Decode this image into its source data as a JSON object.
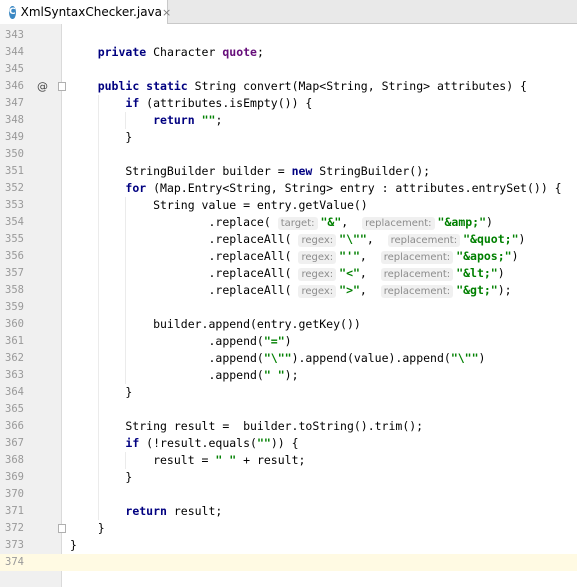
{
  "tab": {
    "icon_label": "C",
    "title": "XmlSyntaxChecker.java",
    "close_label": "×"
  },
  "gutter": {
    "annotation": "@"
  },
  "lines": [
    {
      "num": "343",
      "html": ""
    },
    {
      "num": "344",
      "html": "    <span class=\"kw\">private</span> Character <span class=\"fld\">quote</span>;"
    },
    {
      "num": "345",
      "html": ""
    },
    {
      "num": "346",
      "html": "    <span class=\"kw\">public static</span> String convert(Map&lt;String, String&gt; attributes) {"
    },
    {
      "num": "347",
      "html": "        <span class=\"kw\">if</span> (attributes.isEmpty()) {"
    },
    {
      "num": "348",
      "html": "            <span class=\"kw\">return</span> <span class=\"str\">\"\"</span>;"
    },
    {
      "num": "349",
      "html": "        }"
    },
    {
      "num": "350",
      "html": ""
    },
    {
      "num": "351",
      "html": "        StringBuilder builder = <span class=\"kw\">new</span> StringBuilder();"
    },
    {
      "num": "352",
      "html": "        <span class=\"kw\">for</span> (Map.Entry&lt;String, String&gt; entry : attributes.entrySet()) {"
    },
    {
      "num": "353",
      "html": "            String value = entry.getValue()"
    },
    {
      "num": "354",
      "html": "                    .replace( <span class=\"hint\">target:</span><span class=\"str\">\"&amp;\"</span>,  <span class=\"hint\">replacement:</span><span class=\"str\">\"&amp;amp;\"</span>)"
    },
    {
      "num": "355",
      "html": "                    .replaceAll( <span class=\"hint\">regex:</span><span class=\"str\">\"\\\"\"</span>,  <span class=\"hint\">replacement:</span><span class=\"str\">\"&amp;quot;\"</span>)"
    },
    {
      "num": "356",
      "html": "                    .replaceAll( <span class=\"hint\">regex:</span><span class=\"str\">\"'\"</span>,  <span class=\"hint\">replacement:</span><span class=\"str\">\"&amp;apos;\"</span>)"
    },
    {
      "num": "357",
      "html": "                    .replaceAll( <span class=\"hint\">regex:</span><span class=\"str\">\"&lt;\"</span>,  <span class=\"hint\">replacement:</span><span class=\"str\">\"&amp;lt;\"</span>)"
    },
    {
      "num": "358",
      "html": "                    .replaceAll( <span class=\"hint\">regex:</span><span class=\"str\">\"&gt;\"</span>,  <span class=\"hint\">replacement:</span><span class=\"str\">\"&amp;gt;\"</span>);"
    },
    {
      "num": "359",
      "html": ""
    },
    {
      "num": "360",
      "html": "            builder.append(entry.getKey())"
    },
    {
      "num": "361",
      "html": "                    .append(<span class=\"str\">\"=\"</span>)"
    },
    {
      "num": "362",
      "html": "                    .append(<span class=\"str\">\"\\\"\"</span>).append(value).append(<span class=\"str\">\"\\\"\"</span>)"
    },
    {
      "num": "363",
      "html": "                    .append(<span class=\"str\">\" \"</span>);"
    },
    {
      "num": "364",
      "html": "        }"
    },
    {
      "num": "365",
      "html": ""
    },
    {
      "num": "366",
      "html": "        String result =  builder.toString().trim();"
    },
    {
      "num": "367",
      "html": "        <span class=\"kw\">if</span> (!result.equals(<span class=\"str\">\"\"</span>)) {"
    },
    {
      "num": "368",
      "html": "            result = <span class=\"str\">\" \"</span> + result;"
    },
    {
      "num": "369",
      "html": "        }"
    },
    {
      "num": "370",
      "html": ""
    },
    {
      "num": "371",
      "html": "        <span class=\"kw\">return</span> result;"
    },
    {
      "num": "372",
      "html": "    }"
    },
    {
      "num": "373",
      "html": "}"
    },
    {
      "num": "374",
      "html": ""
    }
  ],
  "current_line": "374",
  "colors": {
    "keyword": "#000080",
    "string": "#008000",
    "field": "#660e7a",
    "line_number": "#999999",
    "current_line_bg": "#fffae3"
  }
}
